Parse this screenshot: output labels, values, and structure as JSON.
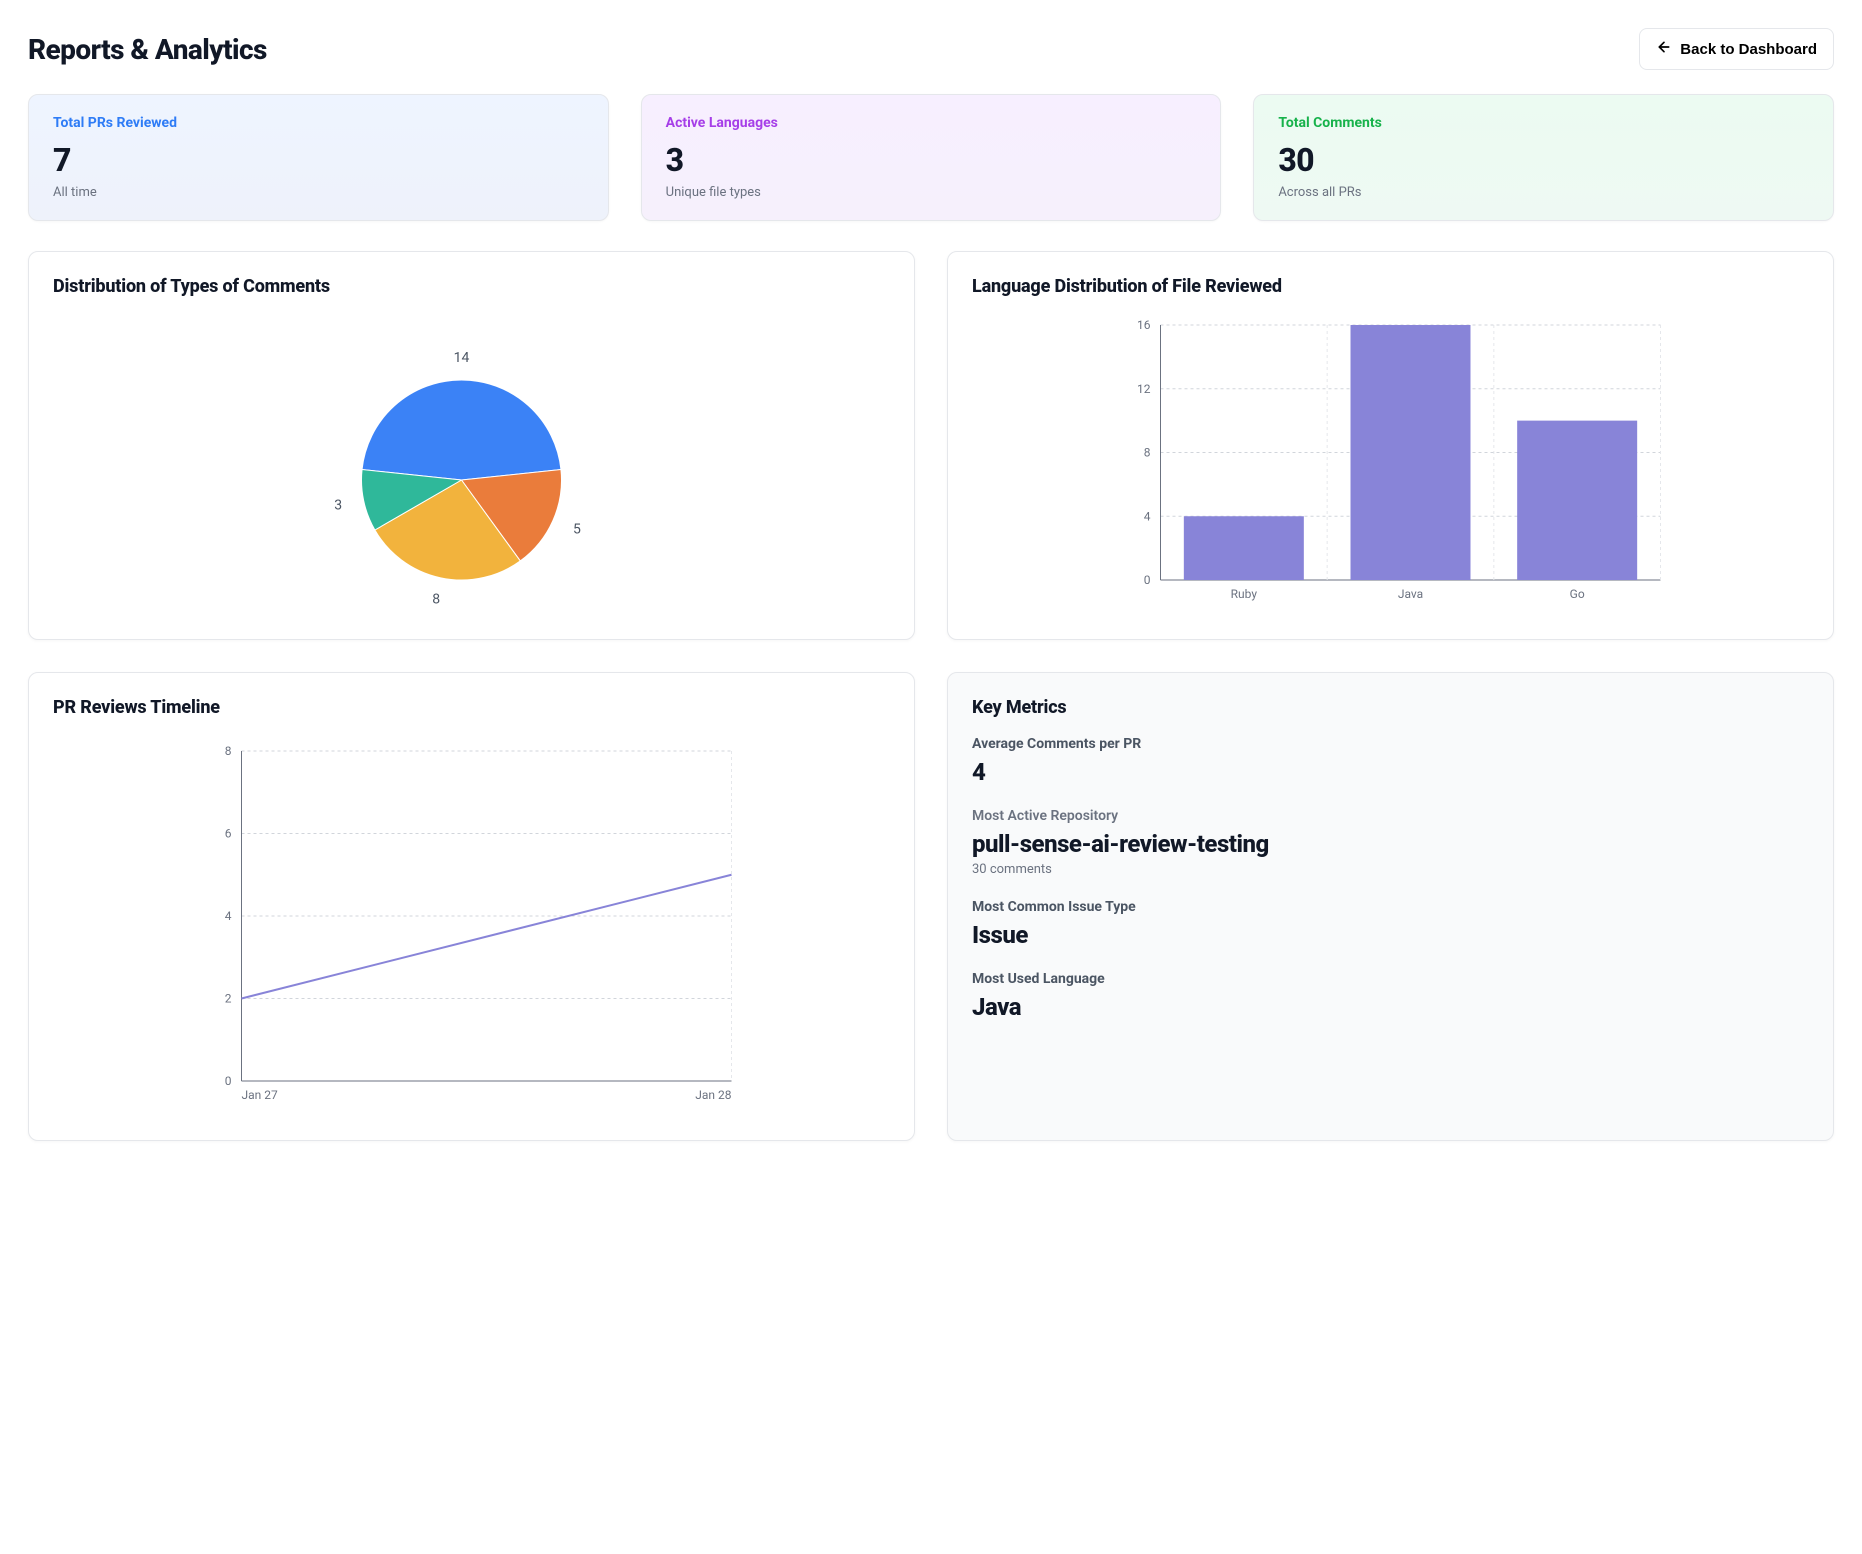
{
  "header": {
    "title": "Reports & Analytics",
    "back_label": "Back to Dashboard"
  },
  "stats": [
    {
      "label": "Total PRs Reviewed",
      "value": "7",
      "sub": "All time",
      "variant": "blue"
    },
    {
      "label": "Active Languages",
      "value": "3",
      "sub": "Unique file types",
      "variant": "purple"
    },
    {
      "label": "Total Comments",
      "value": "30",
      "sub": "Across all PRs",
      "variant": "green"
    }
  ],
  "pie_card_title": "Distribution of Types of Comments",
  "bar_card_title": "Language Distribution of File Reviewed",
  "line_card_title": "PR Reviews Timeline",
  "metrics_card_title": "Key Metrics",
  "metrics": {
    "avg_comments_label": "Average Comments per PR",
    "avg_comments_value": "4",
    "most_active_repo_label": "Most Active Repository",
    "most_active_repo_value": "pull-sense-ai-review-testing",
    "most_active_repo_note": "30 comments",
    "most_common_issue_label": "Most Common Issue Type",
    "most_common_issue_value": "Issue",
    "most_used_lang_label": "Most Used Language",
    "most_used_lang_value": "Java"
  },
  "chart_data": [
    {
      "id": "comment_types_pie",
      "type": "pie",
      "title": "Distribution of Types of Comments",
      "values": [
        14,
        5,
        8,
        3
      ],
      "colors": [
        "#3b82f6",
        "#ea7c3b",
        "#f2b33d",
        "#2fb89a"
      ]
    },
    {
      "id": "language_bar",
      "type": "bar",
      "title": "Language Distribution of File Reviewed",
      "categories": [
        "Ruby",
        "Java",
        "Go"
      ],
      "values": [
        4,
        16,
        10
      ],
      "ylim": [
        0,
        16
      ],
      "yticks": [
        0,
        4,
        8,
        12,
        16
      ],
      "color": "#8884d8"
    },
    {
      "id": "pr_timeline",
      "type": "line",
      "title": "PR Reviews Timeline",
      "x": [
        "Jan 27",
        "Jan 28"
      ],
      "y": [
        2,
        5
      ],
      "ylim": [
        0,
        8
      ],
      "yticks": [
        0,
        2,
        4,
        6,
        8
      ],
      "color": "#8884d8"
    }
  ]
}
